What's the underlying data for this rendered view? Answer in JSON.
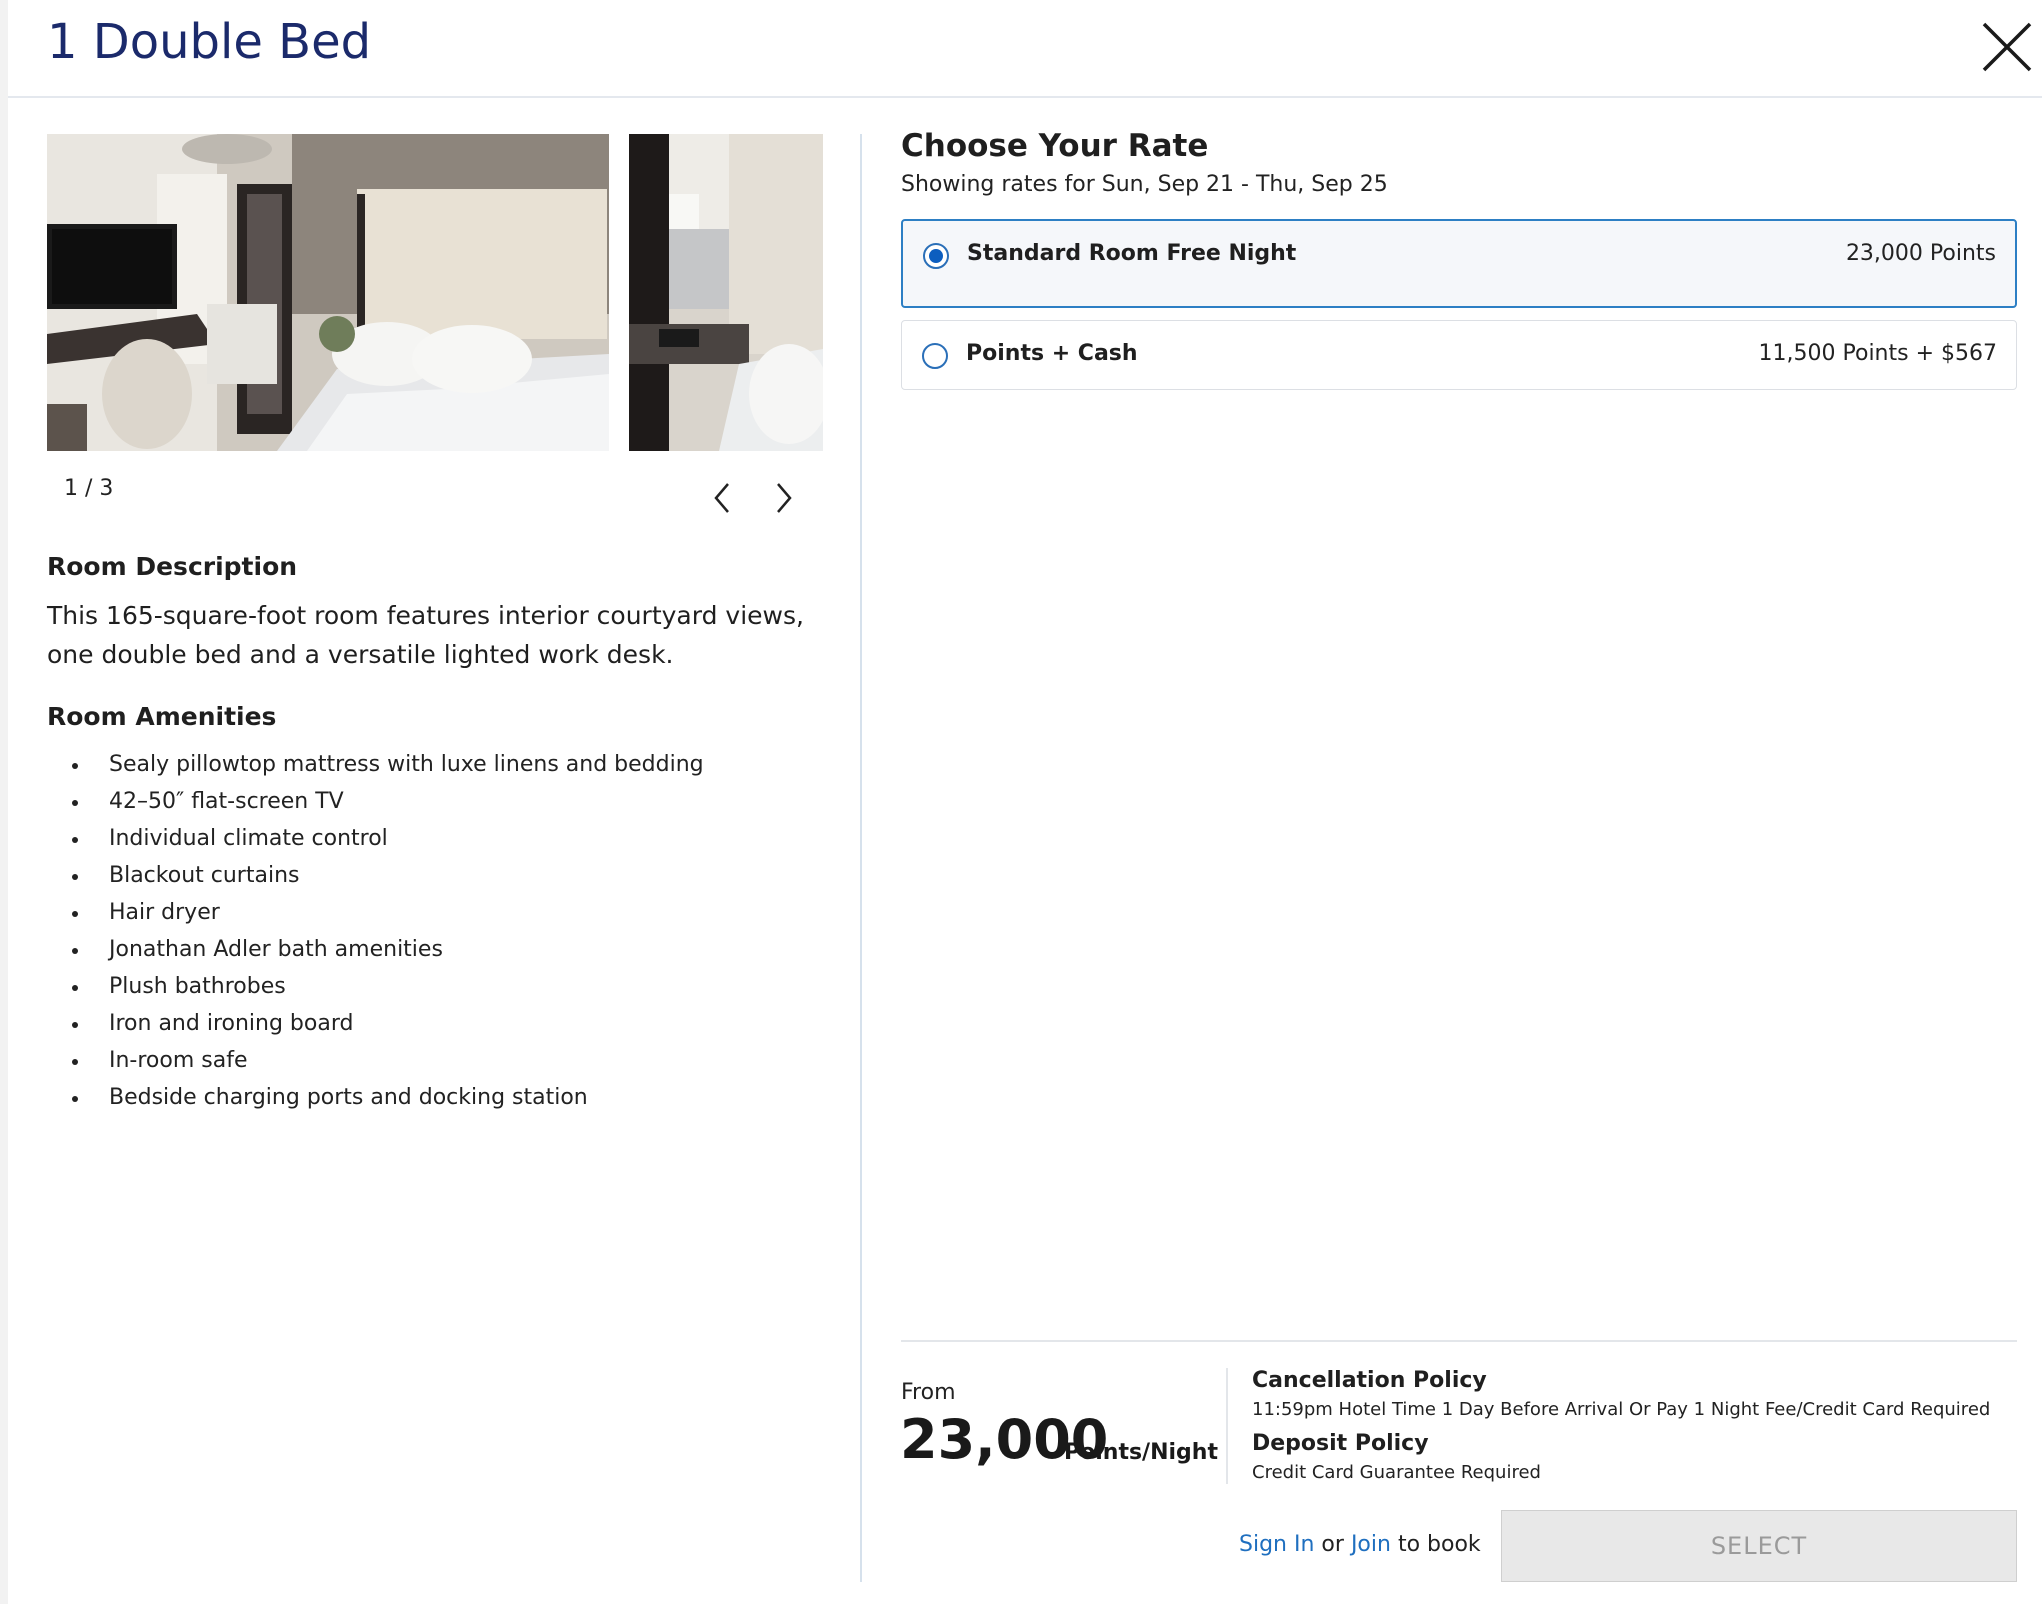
{
  "modal": {
    "title": "1 Double Bed"
  },
  "gallery": {
    "counter": "1 / 3",
    "photos": [
      "room-photo-1",
      "room-photo-2"
    ]
  },
  "room": {
    "description_heading": "Room Description",
    "description": "This 165-square-foot room features interior courtyard views, one double bed and a versatile lighted work desk.",
    "amenities_heading": "Room Amenities",
    "amenities": [
      "Sealy pillowtop mattress with luxe linens and bedding",
      "42–50″ flat-screen TV",
      "Individual climate control",
      "Blackout curtains",
      "Hair dryer",
      "Jonathan Adler bath amenities",
      "Plush bathrobes",
      "Iron and ironing board",
      "In-room safe",
      "Bedside charging ports and docking station"
    ]
  },
  "rates": {
    "heading": "Choose Your Rate",
    "subtitle": "Showing rates for Sun, Sep 21 - Thu, Sep 25",
    "options": [
      {
        "name": "Standard Room Free Night",
        "price": "23,000 Points",
        "selected": true
      },
      {
        "name": "Points + Cash",
        "price": "11,500 Points + $567",
        "selected": false
      }
    ]
  },
  "summary": {
    "from_label": "From",
    "points": "23,000",
    "unit": "Points/Night",
    "cancellation_heading": "Cancellation Policy",
    "cancellation_text": "11:59pm Hotel Time 1 Day Before Arrival Or Pay 1 Night Fee/Credit Card Required",
    "deposit_heading": "Deposit Policy",
    "deposit_text": "Credit Card Guarantee Required"
  },
  "booking": {
    "sign_in": "Sign In",
    "or": "or",
    "join": "Join",
    "to_book": "to book",
    "select_label": "SELECT"
  },
  "colors": {
    "title": "#1b2a6b",
    "accent": "#0c5ebf",
    "link": "#1f6fbf",
    "selected_border": "#2d7fc4"
  }
}
